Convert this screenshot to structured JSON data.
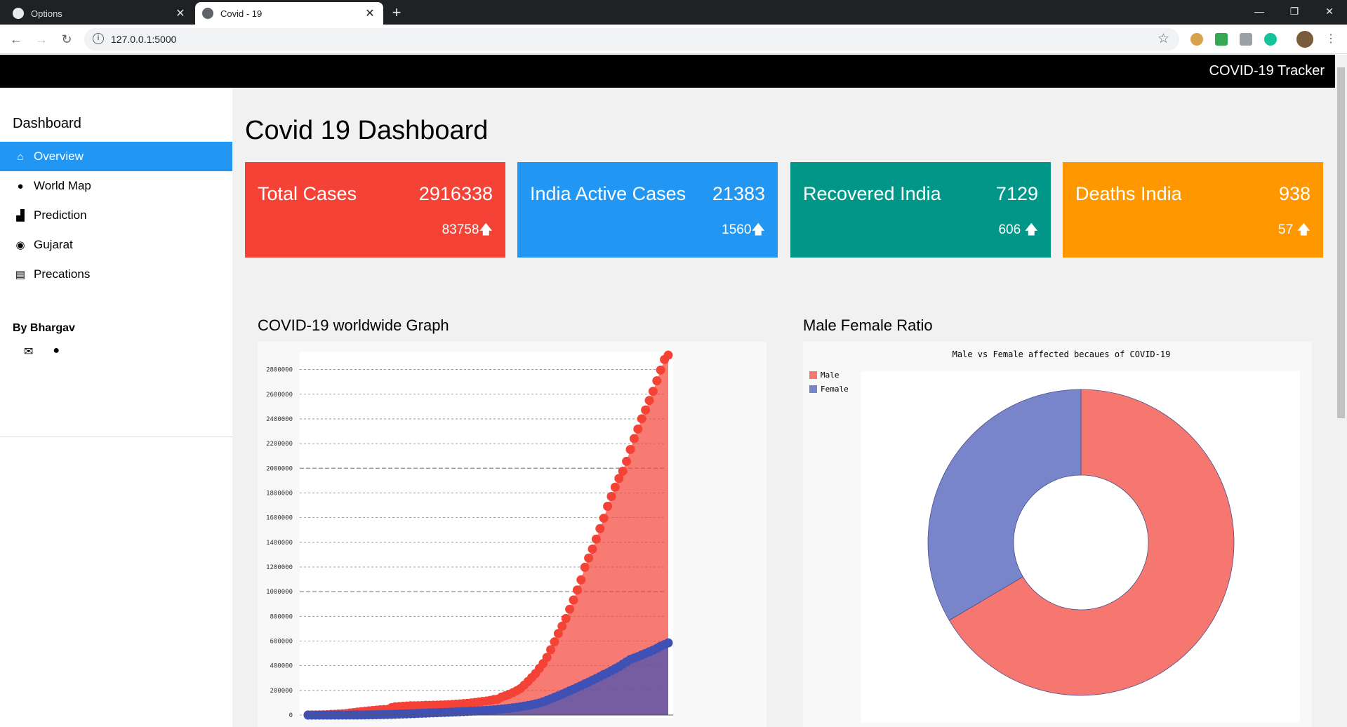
{
  "browser": {
    "tabs": [
      {
        "title": "Options",
        "active": false,
        "icon": "github-icon"
      },
      {
        "title": "Covid - 19",
        "active": true,
        "icon": "globe-icon"
      }
    ],
    "url": "127.0.0.1:5000"
  },
  "topbar": {
    "brand": "COVID-19 Tracker"
  },
  "sidebar": {
    "heading": "Dashboard",
    "items": [
      {
        "label": "Overview",
        "icon": "home-icon",
        "active": true
      },
      {
        "label": "World Map",
        "icon": "globe-icon",
        "active": false
      },
      {
        "label": "Prediction",
        "icon": "area-chart-icon",
        "active": false
      },
      {
        "label": "Gujarat",
        "icon": "compass-icon",
        "active": false
      },
      {
        "label": "Precations",
        "icon": "newspaper-icon",
        "active": false
      }
    ],
    "author": "By Bhargav",
    "author_icons": [
      "envelope-icon",
      "user-icon"
    ]
  },
  "main": {
    "title": "Covid 19 Dashboard",
    "cards": [
      {
        "title": "Total Cases",
        "value": "2916338",
        "delta": "83758",
        "color": "#f44336"
      },
      {
        "title": "India Active Cases",
        "value": "21383",
        "delta": "1560",
        "color": "#2196f3"
      },
      {
        "title": "Recovered India",
        "value": "7129",
        "delta": "606",
        "color": "#009688"
      },
      {
        "title": "Deaths India",
        "value": "938",
        "delta": "57",
        "color": "#ff9800"
      }
    ],
    "graph_title": "COVID-19 worldwide Graph",
    "ratio_title": "Male Female Ratio"
  },
  "chart_data": [
    {
      "type": "area",
      "title": "",
      "ylim": [
        0,
        2900000
      ],
      "yticks": [
        0,
        200000,
        400000,
        600000,
        800000,
        1000000,
        1200000,
        1400000,
        1600000,
        1800000,
        2000000,
        2200000,
        2400000,
        2600000,
        2800000
      ],
      "grid": true,
      "legend": "none",
      "series": [
        {
          "values": [
            555,
            654,
            941,
            1434,
            2118,
            2927,
            5578,
            6166,
            8234,
            9927,
            12038,
            16787,
            19881,
            23892,
            27635,
            30817,
            34391,
            37120,
            40150,
            42762,
            44802,
            45221,
            60368,
            66885,
            69030,
            71224,
            73258,
            75136,
            75639,
            76197,
            76819,
            78572,
            78958,
            79561,
            80406,
            81388,
            82746,
            84112,
            86011,
            88369,
            90306,
            92840,
            95120,
            97886,
            101800,
            105847,
            109821,
            113590,
            118620,
            125875,
            128343,
            145193,
            156099,
            167447,
            181546,
            197168,
            214915,
            242713,
            272167,
            304528,
            336953,
            378235,
            418045,
            467653,
            529591,
            593291,
            660706,
            720117,
            782365,
            857487,
            932605,
            1013466,
            1095917,
            1197405,
            1272115,
            1345101,
            1426096,
            1511104,
            1595350,
            1691719,
            1771514,
            1846680,
            1917320,
            1976191,
            2056054,
            2152437,
            2240191,
            2317759,
            2401378,
            2472259,
            2549294,
            2623415,
            2708885,
            2795731,
            2881140,
            2916338
          ],
          "color": "#f44336"
        },
        {
          "values": [
            28,
            30,
            36,
            39,
            52,
            61,
            107,
            126,
            143,
            222,
            284,
            468,
            532,
            637,
            944,
            1240,
            1707,
            2115,
            2612,
            3237,
            3965,
            4614,
            5587,
            6689,
            7793,
            8754,
            9917,
            10931,
            12212,
            13366,
            14514,
            15706,
            16889,
            18009,
            19124,
            20297,
            21621,
            22882,
            24052,
            25328,
            26643,
            27967,
            29459,
            31027,
            32619,
            34296,
            36048,
            37984,
            40154,
            42656,
            45228,
            48205,
            51164,
            54567,
            58366,
            62608,
            67038,
            72610,
            77757,
            83405,
            89977,
            97568,
            107617,
            118614,
            130657,
            143958,
            155765,
            168857,
            182914,
            196802,
            209980,
            224131,
            238459,
            253102,
            266802,
            282107,
            297134,
            312131,
            329130,
            342580,
            359131,
            375783,
            392381,
            412054,
            431521,
            450785,
            462231,
            473453,
            487631,
            499803,
            513110,
            526001,
            541015,
            558219,
            571431,
            585102
          ],
          "color": "#3f51b5"
        }
      ]
    },
    {
      "type": "pie",
      "title": "Male vs Female affected becaues of COVID-19",
      "legend": "top-left",
      "slices": [
        {
          "label": "Male",
          "value": 66.5,
          "color": "#f57770"
        },
        {
          "label": "Female",
          "value": 33.5,
          "color": "#7985cb"
        }
      ]
    }
  ]
}
